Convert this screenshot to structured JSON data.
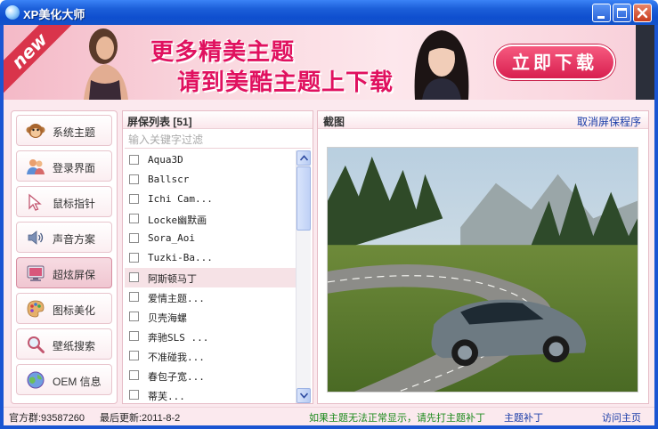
{
  "window": {
    "title": "XP美化大师"
  },
  "banner": {
    "badge": "new",
    "line1": "更多精美主题",
    "line2": "请到美酷主题上下载",
    "download_button": "立即下载"
  },
  "sidebar": {
    "items": [
      {
        "label": "系统主题",
        "icon": "monkey-face-icon",
        "active": false
      },
      {
        "label": "登录界面",
        "icon": "users-icon",
        "active": false
      },
      {
        "label": "鼠标指针",
        "icon": "cursor-icon",
        "active": false
      },
      {
        "label": "声音方案",
        "icon": "speaker-icon",
        "active": false
      },
      {
        "label": "超炫屏保",
        "icon": "monitor-icon",
        "active": true
      },
      {
        "label": "图标美化",
        "icon": "palette-icon",
        "active": false
      },
      {
        "label": "壁纸搜索",
        "icon": "magnifier-icon",
        "active": false
      },
      {
        "label": "OEM 信息",
        "icon": "globe-icon",
        "active": false
      }
    ]
  },
  "screensaver_list": {
    "header": "屏保列表 [51]",
    "filter_placeholder": "输入关键字过滤",
    "items": [
      {
        "label": "Aqua3D",
        "checked": false,
        "selected": false
      },
      {
        "label": "Ballscr",
        "checked": false,
        "selected": false
      },
      {
        "label": "Ichi Cam...",
        "checked": false,
        "selected": false
      },
      {
        "label": "Locke幽默画",
        "checked": false,
        "selected": false
      },
      {
        "label": "Sora_Aoi",
        "checked": false,
        "selected": false
      },
      {
        "label": "Tuzki-Ba...",
        "checked": false,
        "selected": false
      },
      {
        "label": "阿斯顿马丁",
        "checked": false,
        "selected": true
      },
      {
        "label": "爱情主题...",
        "checked": false,
        "selected": false
      },
      {
        "label": "贝壳海螺",
        "checked": false,
        "selected": false
      },
      {
        "label": "奔驰SLS ...",
        "checked": false,
        "selected": false
      },
      {
        "label": "不准碰我...",
        "checked": false,
        "selected": false
      },
      {
        "label": "春包子宽...",
        "checked": false,
        "selected": false
      },
      {
        "label": "蒂芙...",
        "checked": false,
        "selected": false
      }
    ]
  },
  "preview": {
    "title": "截图",
    "cancel_link": "取消屏保程序"
  },
  "statusbar": {
    "group": "官方群:93587260",
    "last_update": "最后更新:2011-8-2",
    "tip": "如果主题无法正常显示，请先打主题补丁",
    "patch_link": "主题补丁",
    "home_link": "访问主页"
  },
  "colors": {
    "titlebar": "#0f4fcf",
    "accent_pink": "#e0115f",
    "panel_bg": "#fbe9ee",
    "link": "#1a3da8",
    "tip_green": "#1c8a1c"
  }
}
